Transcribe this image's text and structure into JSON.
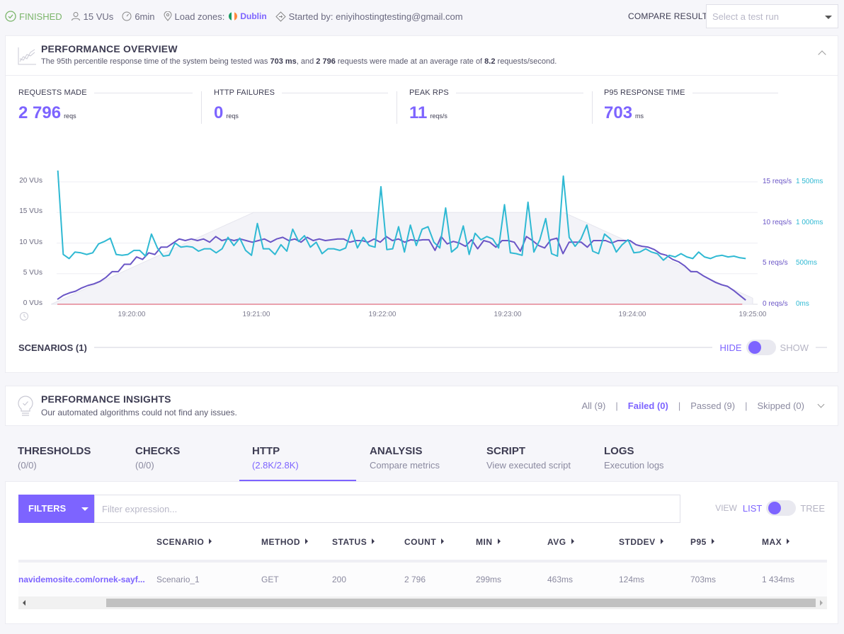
{
  "topbar": {
    "status": "FINISHED",
    "vus": "15 VUs",
    "duration": "6min",
    "load_zones_label": "Load zones:",
    "load_zone": "Dublin",
    "started_by": "Started by: eniyihostingtesting@gmail.com",
    "compare_label": "COMPARE RESULT",
    "compare_placeholder": "Select a test run"
  },
  "overview": {
    "title": "PERFORMANCE OVERVIEW",
    "summary_prefix": "The 95th percentile response time of the system being tested was ",
    "summary_p95": "703 ms",
    "summary_mid": ", and ",
    "summary_requests": "2 796",
    "summary_mid2": " requests were made at an average rate of ",
    "summary_rate": "8.2",
    "summary_suffix": " requests/second.",
    "stats": [
      {
        "label": "REQUESTS MADE",
        "value": "2 796",
        "unit": "reqs"
      },
      {
        "label": "HTTP FAILURES",
        "value": "0",
        "unit": "reqs"
      },
      {
        "label": "PEAK RPS",
        "value": "11",
        "unit": "reqs/s"
      },
      {
        "label": "P95 RESPONSE TIME",
        "value": "703",
        "unit": "ms"
      }
    ]
  },
  "chart_data": {
    "type": "line",
    "title": "",
    "x_unit": "seconds since 19:19:24",
    "x_ticks": [
      "19:20:00",
      "19:21:00",
      "19:22:00",
      "19:23:00",
      "19:24:00",
      "19:25:00"
    ],
    "y_left_ticks": [
      "0 VUs",
      "5 VUs",
      "10 VUs",
      "15 VUs",
      "20 VUs"
    ],
    "y_right_rps_ticks": [
      "0 reqs/s",
      "5 reqs/s",
      "10 reqs/s",
      "15 reqs/s"
    ],
    "y_right_ms_ticks": [
      "0ms",
      "500ms",
      "1 000ms",
      "1 500ms"
    ],
    "ylim_vus": [
      0,
      20
    ],
    "ylim_rps": [
      0,
      15
    ],
    "ylim_ms": [
      0,
      1500
    ],
    "grid": true,
    "series": [
      {
        "name": "VUs",
        "color": "#e6e6ee",
        "kind": "area",
        "points": [
          [
            0,
            0
          ],
          [
            10,
            1
          ],
          [
            20,
            2
          ],
          [
            30,
            3
          ],
          [
            40,
            4
          ],
          [
            50,
            5
          ],
          [
            60,
            6
          ],
          [
            70,
            7
          ],
          [
            80,
            8
          ],
          [
            90,
            9
          ],
          [
            100,
            10
          ],
          [
            110,
            11
          ],
          [
            120,
            12
          ],
          [
            130,
            13
          ],
          [
            140,
            14
          ],
          [
            150,
            15
          ],
          [
            270,
            15
          ],
          [
            380,
            15
          ],
          [
            390,
            14
          ],
          [
            400,
            13
          ],
          [
            410,
            12
          ],
          [
            420,
            11
          ],
          [
            430,
            10
          ],
          [
            440,
            9
          ],
          [
            450,
            8
          ],
          [
            460,
            7
          ],
          [
            470,
            6
          ],
          [
            480,
            5
          ],
          [
            490,
            4
          ],
          [
            500,
            3
          ],
          [
            510,
            2
          ],
          [
            520,
            1
          ],
          [
            335,
            15
          ]
        ]
      },
      {
        "name": "Request rate (reqs/s)",
        "color": "#6a55c6",
        "kind": "line",
        "points": [
          [
            0,
            0.6
          ],
          [
            4,
            1.1
          ],
          [
            8,
            1.4
          ],
          [
            12,
            1.6
          ],
          [
            16,
            2.0
          ],
          [
            20,
            2.3
          ],
          [
            24,
            2.5
          ],
          [
            28,
            2.8
          ],
          [
            32,
            3.3
          ],
          [
            36,
            4.0
          ],
          [
            40,
            4.0
          ],
          [
            44,
            4.9
          ],
          [
            48,
            4.9
          ],
          [
            52,
            5.8
          ],
          [
            56,
            5.5
          ],
          [
            60,
            6.3
          ],
          [
            64,
            6.1
          ],
          [
            68,
            7.0
          ],
          [
            72,
            7.0
          ],
          [
            76,
            7.5
          ],
          [
            80,
            8.0
          ],
          [
            84,
            7.8
          ],
          [
            88,
            8.0
          ],
          [
            92,
            7.8
          ],
          [
            96,
            8.0
          ],
          [
            100,
            7.6
          ],
          [
            104,
            8.3
          ],
          [
            108,
            7.8
          ],
          [
            112,
            8.0
          ],
          [
            116,
            7.8
          ],
          [
            120,
            8.0
          ],
          [
            124,
            7.8
          ],
          [
            128,
            7.6
          ],
          [
            132,
            7.8
          ],
          [
            136,
            8.0
          ],
          [
            140,
            7.6
          ],
          [
            144,
            8.0
          ],
          [
            148,
            8.2
          ],
          [
            152,
            7.8
          ],
          [
            156,
            8.0
          ],
          [
            160,
            7.6
          ],
          [
            164,
            8.2
          ],
          [
            168,
            7.8
          ],
          [
            172,
            8.0
          ],
          [
            176,
            7.8
          ],
          [
            180,
            7.9
          ],
          [
            184,
            8.0
          ],
          [
            188,
            8.0
          ],
          [
            192,
            7.6
          ],
          [
            196,
            7.8
          ],
          [
            200,
            7.8
          ],
          [
            204,
            7.6
          ],
          [
            208,
            8.0
          ],
          [
            212,
            7.6
          ],
          [
            216,
            8.3
          ],
          [
            220,
            7.8
          ],
          [
            224,
            8.0
          ],
          [
            228,
            7.6
          ],
          [
            232,
            7.9
          ],
          [
            236,
            7.8
          ],
          [
            240,
            7.9
          ],
          [
            244,
            7.9
          ],
          [
            248,
            6.6
          ],
          [
            252,
            8.3
          ],
          [
            256,
            7.4
          ],
          [
            260,
            7.7
          ],
          [
            264,
            7.5
          ],
          [
            268,
            7.1
          ],
          [
            272,
            7.9
          ],
          [
            276,
            6.8
          ],
          [
            280,
            7.8
          ],
          [
            284,
            7.6
          ],
          [
            288,
            7.0
          ],
          [
            292,
            7.8
          ],
          [
            296,
            7.8
          ],
          [
            300,
            7.6
          ],
          [
            304,
            6.5
          ],
          [
            308,
            8.3
          ],
          [
            312,
            7.8
          ],
          [
            316,
            7.2
          ],
          [
            320,
            6.9
          ],
          [
            324,
            7.9
          ],
          [
            328,
            8.1
          ],
          [
            332,
            6.2
          ],
          [
            336,
            7.6
          ],
          [
            340,
            7.6
          ],
          [
            344,
            7.6
          ],
          [
            348,
            7.0
          ],
          [
            352,
            7.8
          ],
          [
            356,
            7.8
          ],
          [
            360,
            7.8
          ],
          [
            364,
            7.5
          ],
          [
            368,
            7.8
          ],
          [
            372,
            7.8
          ],
          [
            376,
            7.8
          ],
          [
            380,
            7.3
          ],
          [
            384,
            7.1
          ],
          [
            388,
            7.0
          ],
          [
            392,
            6.7
          ],
          [
            396,
            6.2
          ],
          [
            400,
            6.0
          ],
          [
            404,
            5.5
          ],
          [
            408,
            5.2
          ],
          [
            412,
            4.7
          ],
          [
            416,
            4.0
          ],
          [
            420,
            4.0
          ],
          [
            424,
            3.5
          ],
          [
            428,
            3.1
          ],
          [
            432,
            2.7
          ],
          [
            436,
            2.4
          ],
          [
            440,
            2.2
          ],
          [
            444,
            1.7
          ],
          [
            448,
            1.1
          ],
          [
            452,
            0.5
          ]
        ]
      },
      {
        "name": "Response time (ms)",
        "color": "#2fb9d3",
        "kind": "line",
        "points": [
          [
            0,
            1730
          ],
          [
            4,
            610
          ],
          [
            8,
            560
          ],
          [
            12,
            640
          ],
          [
            16,
            630
          ],
          [
            20,
            610
          ],
          [
            24,
            630
          ],
          [
            28,
            740
          ],
          [
            32,
            770
          ],
          [
            36,
            810
          ],
          [
            40,
            610
          ],
          [
            44,
            600
          ],
          [
            48,
            610
          ],
          [
            52,
            660
          ],
          [
            56,
            660
          ],
          [
            60,
            590
          ],
          [
            64,
            860
          ],
          [
            68,
            690
          ],
          [
            72,
            590
          ],
          [
            76,
            600
          ],
          [
            80,
            750
          ],
          [
            84,
            700
          ],
          [
            88,
            710
          ],
          [
            92,
            700
          ],
          [
            96,
            650
          ],
          [
            100,
            680
          ],
          [
            104,
            680
          ],
          [
            108,
            630
          ],
          [
            112,
            680
          ],
          [
            116,
            820
          ],
          [
            120,
            720
          ],
          [
            124,
            810
          ],
          [
            128,
            660
          ],
          [
            132,
            600
          ],
          [
            136,
            990
          ],
          [
            140,
            680
          ],
          [
            144,
            680
          ],
          [
            148,
            610
          ],
          [
            152,
            730
          ],
          [
            156,
            650
          ],
          [
            160,
            920
          ],
          [
            164,
            770
          ],
          [
            168,
            840
          ],
          [
            172,
            700
          ],
          [
            176,
            760
          ],
          [
            180,
            620
          ],
          [
            184,
            680
          ],
          [
            188,
            680
          ],
          [
            192,
            660
          ],
          [
            196,
            690
          ],
          [
            200,
            910
          ],
          [
            204,
            690
          ],
          [
            208,
            820
          ],
          [
            212,
            720
          ],
          [
            216,
            700
          ],
          [
            220,
            1440
          ],
          [
            224,
            670
          ],
          [
            228,
            680
          ],
          [
            232,
            950
          ],
          [
            236,
            640
          ],
          [
            240,
            970
          ],
          [
            244,
            720
          ],
          [
            248,
            920
          ],
          [
            252,
            950
          ],
          [
            256,
            760
          ],
          [
            260,
            690
          ],
          [
            264,
            1180
          ],
          [
            268,
            640
          ],
          [
            272,
            700
          ],
          [
            276,
            960
          ],
          [
            280,
            610
          ],
          [
            284,
            870
          ],
          [
            288,
            790
          ],
          [
            292,
            830
          ],
          [
            296,
            800
          ],
          [
            300,
            690
          ],
          [
            304,
            1220
          ],
          [
            308,
            630
          ],
          [
            312,
            620
          ],
          [
            316,
            600
          ],
          [
            320,
            1250
          ],
          [
            324,
            640
          ],
          [
            328,
            790
          ],
          [
            332,
            1050
          ],
          [
            336,
            620
          ],
          [
            340,
            590
          ],
          [
            344,
            1570
          ],
          [
            348,
            820
          ],
          [
            352,
            710
          ],
          [
            356,
            800
          ],
          [
            360,
            970
          ],
          [
            364,
            650
          ],
          [
            368,
            620
          ],
          [
            372,
            860
          ],
          [
            376,
            800
          ],
          [
            380,
            640
          ],
          [
            384,
            730
          ],
          [
            388,
            790
          ],
          [
            392,
            630
          ],
          [
            396,
            640
          ],
          [
            400,
            680
          ],
          [
            404,
            640
          ],
          [
            408,
            620
          ],
          [
            412,
            540
          ],
          [
            416,
            600
          ],
          [
            420,
            580
          ],
          [
            424,
            620
          ],
          [
            428,
            580
          ],
          [
            432,
            560
          ],
          [
            436,
            640
          ],
          [
            440,
            580
          ],
          [
            444,
            560
          ],
          [
            448,
            590
          ],
          [
            452,
            600
          ],
          [
            456,
            580
          ],
          [
            460,
            590
          ],
          [
            464,
            570
          ],
          [
            468,
            560
          ]
        ]
      },
      {
        "name": "Failed requests",
        "color": "#e06c7f",
        "kind": "line",
        "points": [
          [
            0,
            0
          ],
          [
            470,
            0
          ]
        ]
      }
    ]
  },
  "scenarios": {
    "title": "SCENARIOS (1)",
    "hide": "HIDE",
    "show": "SHOW"
  },
  "insights": {
    "title": "PERFORMANCE INSIGHTS",
    "subtitle": "Our automated algorithms could not find any issues.",
    "filters": [
      {
        "label": "All (9)"
      },
      {
        "label": "Failed (0)"
      },
      {
        "label": "Passed (9)"
      },
      {
        "label": "Skipped (0)"
      }
    ]
  },
  "tabs": [
    {
      "title": "THRESHOLDS",
      "sub": "(0/0)"
    },
    {
      "title": "CHECKS",
      "sub": "(0/0)"
    },
    {
      "title": "HTTP",
      "sub": "(2.8K/2.8K)"
    },
    {
      "title": "ANALYSIS",
      "sub": "Compare metrics"
    },
    {
      "title": "SCRIPT",
      "sub": "View executed script"
    },
    {
      "title": "LOGS",
      "sub": "Execution logs"
    }
  ],
  "http": {
    "filters_label": "FILTERS",
    "filter_placeholder": "Filter expression...",
    "filter_value": "",
    "view_label": "VIEW",
    "view_list": "LIST",
    "view_tree": "TREE",
    "columns": [
      "SCENARIO",
      "METHOD",
      "STATUS",
      "COUNT",
      "MIN",
      "AVG",
      "STDDEV",
      "P95",
      "MAX"
    ],
    "rows": [
      {
        "url": "navidemosite.com/ornek-sayf...",
        "scenario": "Scenario_1",
        "method": "GET",
        "status": "200",
        "count": "2 796",
        "min": "299ms",
        "avg": "463ms",
        "stddev": "124ms",
        "p95": "703ms",
        "max": "1 434ms"
      }
    ]
  }
}
